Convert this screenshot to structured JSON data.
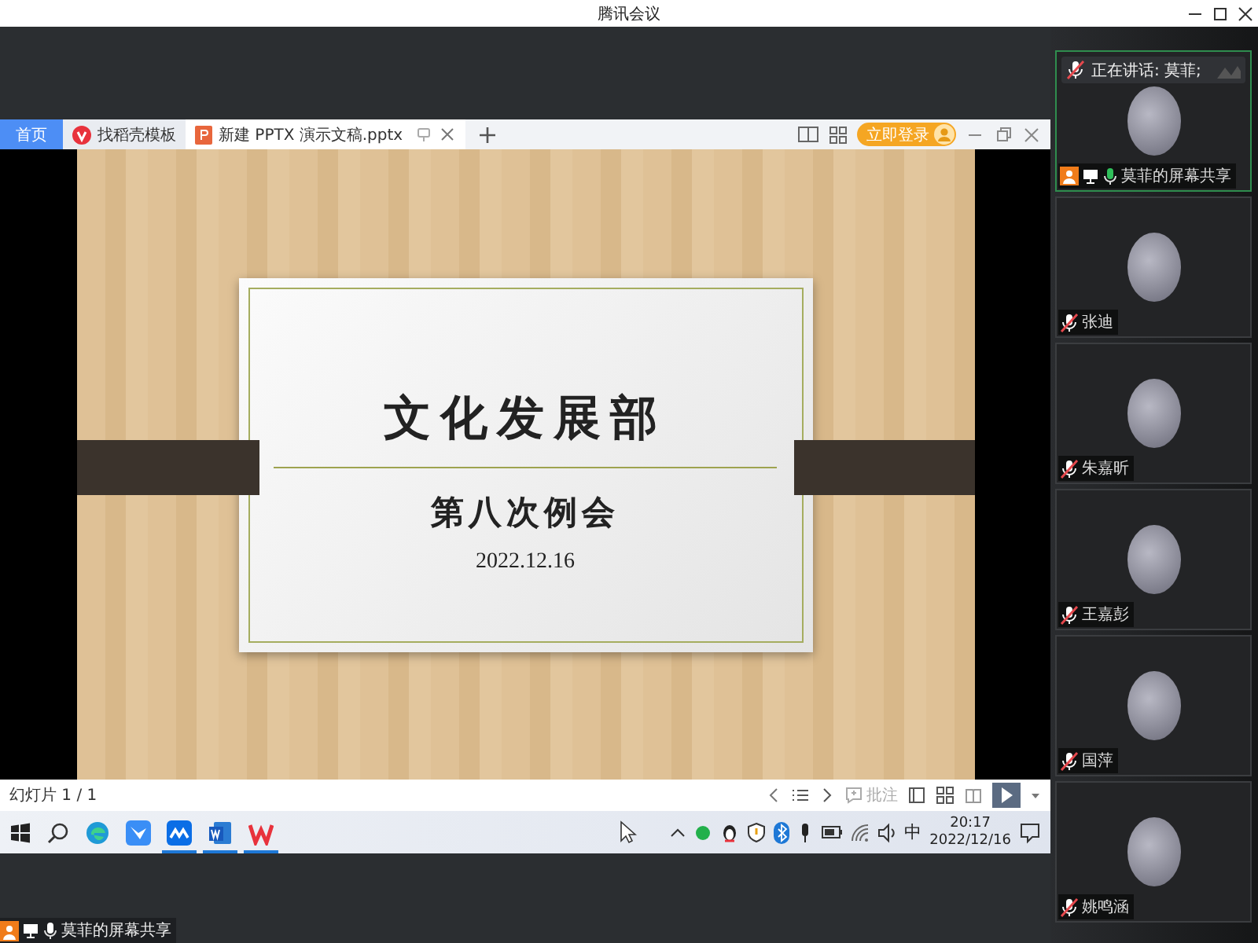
{
  "window": {
    "title": "腾讯会议"
  },
  "shared_screen": {
    "tabs": [
      {
        "label": "首页",
        "selected": false,
        "kind": "home"
      },
      {
        "label": "找稻壳模板",
        "selected": false,
        "kind": "docer"
      },
      {
        "label": "新建 PPTX 演示文稿.pptx",
        "selected": true,
        "kind": "file"
      }
    ],
    "login_button": "立即登录",
    "slide": {
      "title": "文化发展部",
      "subtitle": "第八次例会",
      "date": "2022.12.16"
    },
    "slide_counter": "幻灯片 1 / 1",
    "comment_button": "批注",
    "taskbar": {
      "apps": [
        {
          "kind": "edge",
          "running": false
        },
        {
          "kind": "feishu",
          "running": false
        },
        {
          "kind": "meeting",
          "running": true
        },
        {
          "kind": "word",
          "running": true
        },
        {
          "kind": "wps",
          "running": true
        }
      ],
      "tray_language": "中",
      "time": "20:17",
      "date": "2022/12/16"
    }
  },
  "sharer_label": "莫菲的屏幕共享",
  "speaking": {
    "label": "正在讲话: 莫菲;"
  },
  "participants": [
    {
      "name": "莫菲的屏幕共享",
      "selected": true,
      "sharing": true
    },
    {
      "name": "张迪",
      "selected": false,
      "sharing": false
    },
    {
      "name": "朱嘉昕",
      "selected": false,
      "sharing": false
    },
    {
      "name": "王嘉彭",
      "selected": false,
      "sharing": false
    },
    {
      "name": "国萍",
      "selected": false,
      "sharing": false
    },
    {
      "name": "姚鸣涵",
      "selected": false,
      "sharing": false
    }
  ]
}
